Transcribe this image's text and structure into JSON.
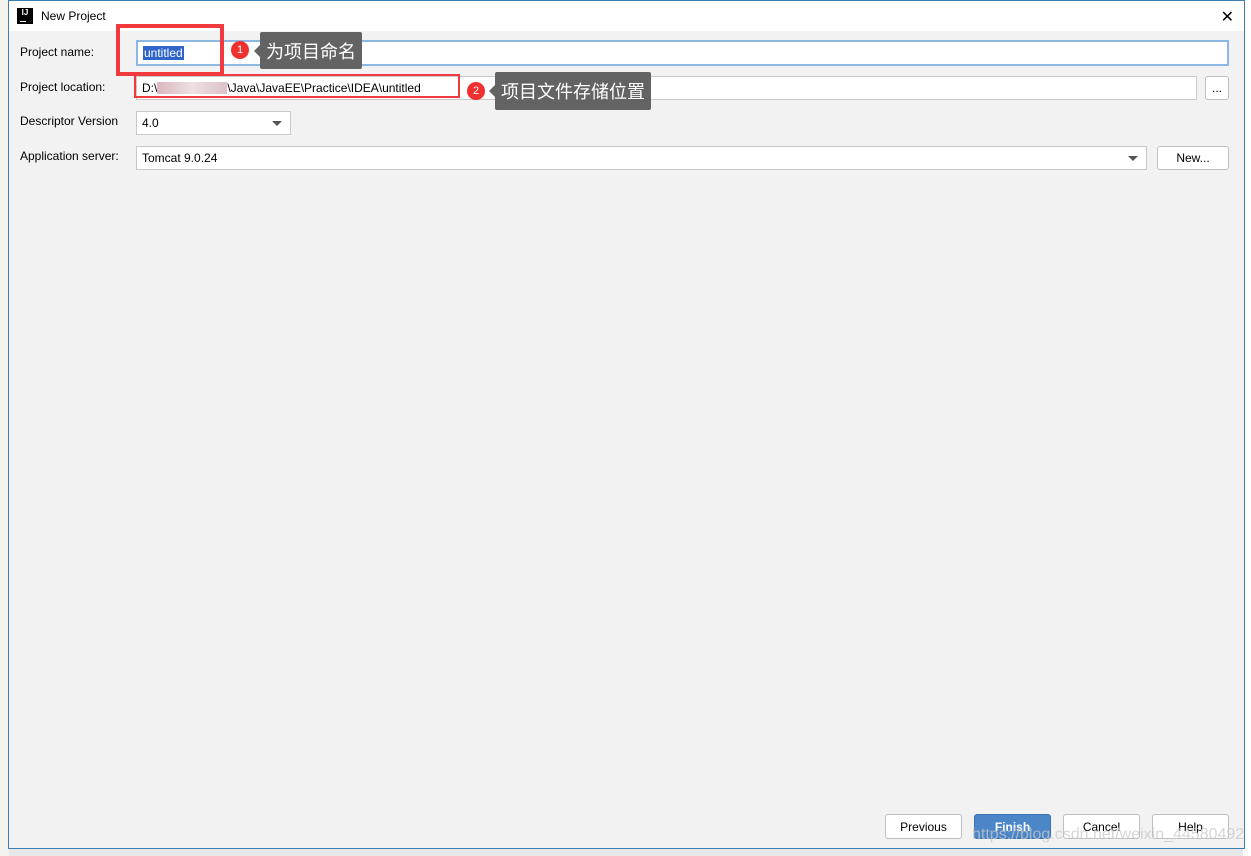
{
  "window": {
    "title": "New Project",
    "close_icon": "close-icon",
    "logo": "intellij-idea-logo"
  },
  "form": {
    "project_name": {
      "label": "Project name:",
      "value": "untitled"
    },
    "project_location": {
      "label": "Project location:",
      "value_prefix": "D:\\",
      "value_suffix": "\\Java\\JavaEE\\Practice\\IDEA\\untitled",
      "browse_label": "..."
    },
    "descriptor_version": {
      "label": "Descriptor Version",
      "value": "4.0"
    },
    "application_server": {
      "label": "Application server:",
      "value": "Tomcat 9.0.24",
      "new_label": "New..."
    }
  },
  "annotations": [
    {
      "number": "1",
      "text": "为项目命名"
    },
    {
      "number": "2",
      "text": "项目文件存储位置"
    }
  ],
  "footer": {
    "previous": "Previous",
    "finish": "Finish",
    "cancel": "Cancel",
    "help": "Help"
  },
  "watermark": "https://blog.csdn.net/weixin_44580492",
  "colors": {
    "accent": "#4a86c8",
    "annotation_red": "#f03a3e",
    "tooltip": "#636363"
  }
}
